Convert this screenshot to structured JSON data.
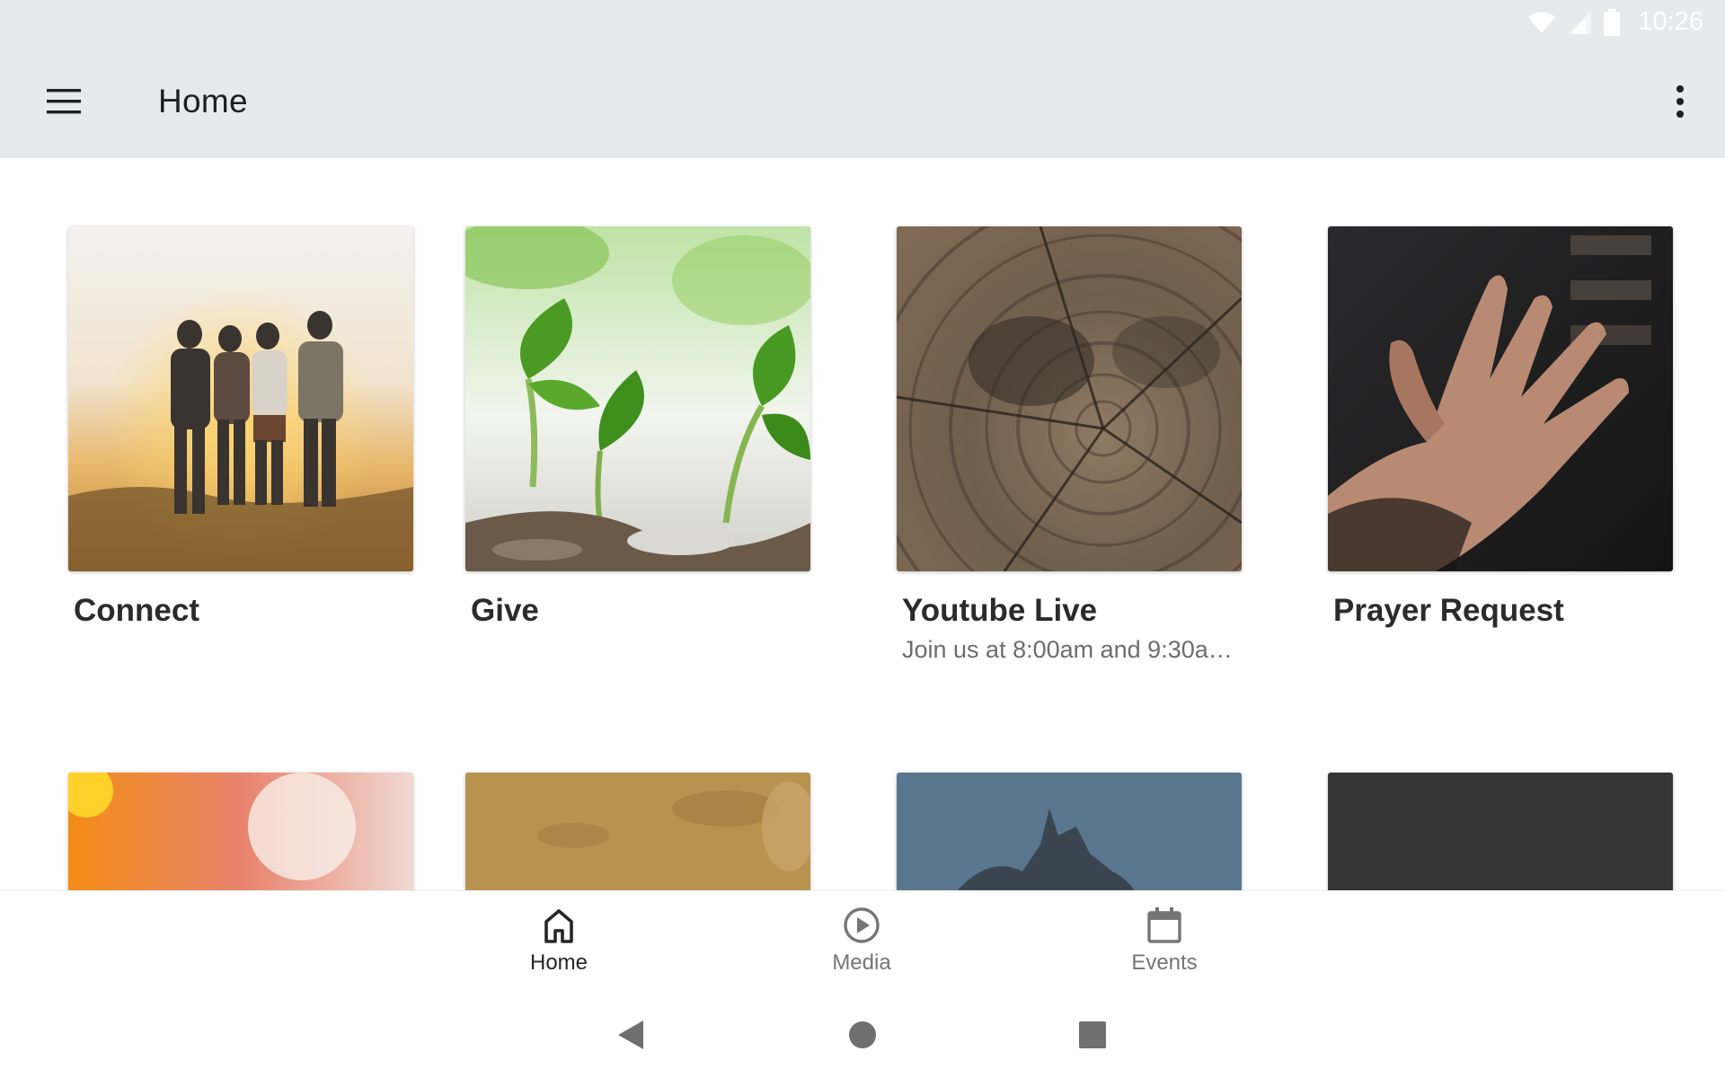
{
  "status_bar": {
    "time": "10:26",
    "icons": [
      "wifi-icon",
      "cell-signal-icon",
      "battery-icon"
    ]
  },
  "app_bar": {
    "title": "Home",
    "menu_icon": "hamburger-menu-icon",
    "overflow_icon": "more-vert-icon"
  },
  "cards": [
    {
      "title": "Connect",
      "subtitle": "",
      "image": "friends-sunset-photo"
    },
    {
      "title": "Give",
      "subtitle": "",
      "image": "green-sprouts-photo"
    },
    {
      "title": "Youtube Live",
      "subtitle": "Join us at 8:00am and 9:30a…",
      "image": "tree-rings-photo"
    },
    {
      "title": "Prayer Request",
      "subtitle": "",
      "image": "open-hand-photo"
    },
    {
      "title": "",
      "subtitle": "",
      "image": "sunburst-orange-photo"
    },
    {
      "title": "",
      "subtitle": "",
      "image": "golden-leaves-photo"
    },
    {
      "title": "",
      "subtitle": "",
      "image": "sea-rocks-photo"
    },
    {
      "title": "",
      "subtitle": "",
      "image": "dark-tile"
    }
  ],
  "bottom_nav": {
    "items": [
      {
        "label": "Home",
        "icon": "home-icon",
        "active": true
      },
      {
        "label": "Media",
        "icon": "play-circle-icon",
        "active": false
      },
      {
        "label": "Events",
        "icon": "calendar-icon",
        "active": false
      }
    ]
  },
  "system_nav": {
    "icons": [
      "back-icon",
      "home-circle-icon",
      "recents-icon"
    ]
  },
  "colors": {
    "app_bar_bg": "#e8e9eb",
    "title_text": "#1f1f1f",
    "card_title": "#2b2b2b",
    "card_subtitle": "#6d6d6d",
    "nav_active": "#262626",
    "nav_inactive": "#757575"
  }
}
